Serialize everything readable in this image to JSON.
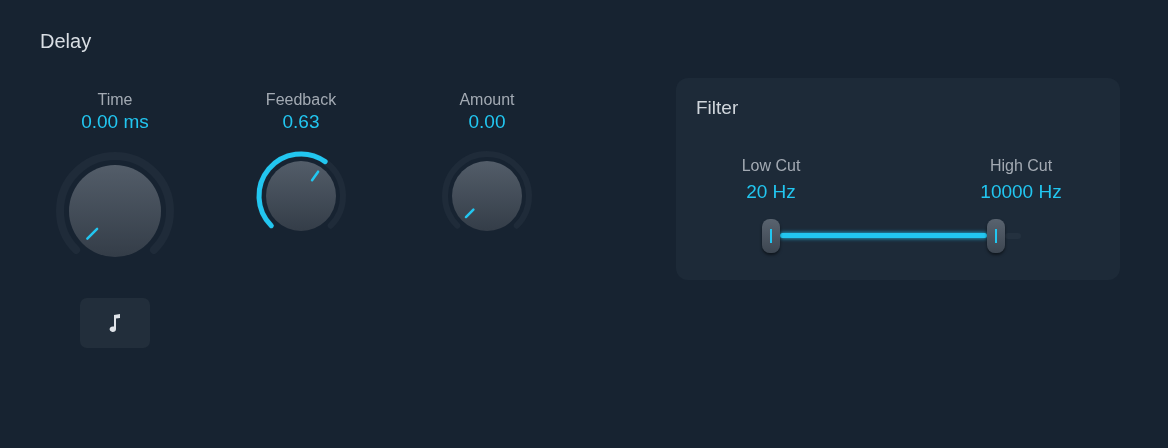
{
  "title": "Delay",
  "knobs": [
    {
      "label": "Time",
      "value": "0.00 ms",
      "kind": "large"
    },
    {
      "label": "Feedback",
      "value": "0.63",
      "kind": "small"
    },
    {
      "label": "Amount",
      "value": "0.00",
      "kind": "small"
    }
  ],
  "filter": {
    "title": "Filter",
    "low_cut": {
      "label": "Low Cut",
      "value": "20 Hz"
    },
    "high_cut": {
      "label": "High Cut",
      "value": "10000 Hz"
    }
  }
}
